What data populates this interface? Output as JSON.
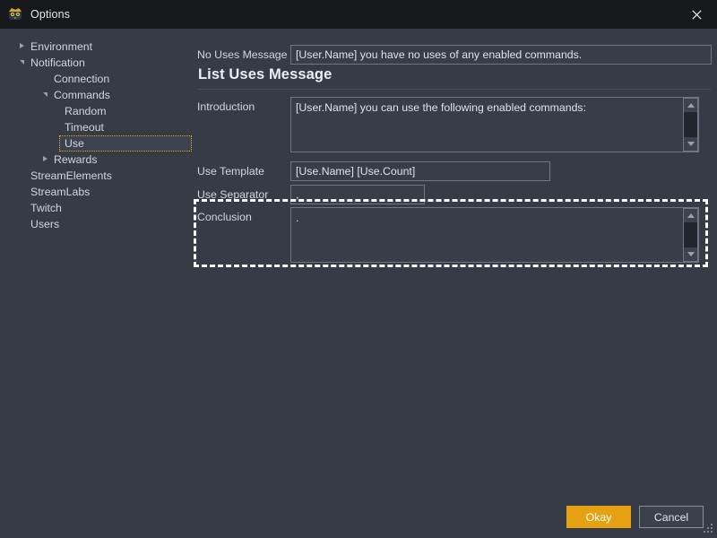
{
  "window": {
    "title": "Options",
    "icon": "app-mascot-icon",
    "close_icon": "close-icon",
    "titlebar_color": "#17181c",
    "background_color": "#363b45",
    "accent_color": "#e5a112",
    "focus_outline_color": "#e2a025"
  },
  "sidebar": {
    "items": [
      {
        "label": "Environment",
        "depth": 0,
        "arrow": "collapsed",
        "selected": false
      },
      {
        "label": "Notification",
        "depth": 0,
        "arrow": "expanded",
        "selected": false
      },
      {
        "label": "Connection",
        "depth": 1,
        "arrow": "none",
        "selected": false
      },
      {
        "label": "Commands",
        "depth": 1,
        "arrow": "expanded",
        "selected": false
      },
      {
        "label": "Random",
        "depth": 2,
        "arrow": "none",
        "selected": false
      },
      {
        "label": "Timeout",
        "depth": 2,
        "arrow": "none",
        "selected": false
      },
      {
        "label": "Use",
        "depth": 2,
        "arrow": "none",
        "selected": true
      },
      {
        "label": "Rewards",
        "depth": 1,
        "arrow": "collapsed",
        "selected": false
      },
      {
        "label": "StreamElements",
        "depth": 0,
        "arrow": "none",
        "selected": false
      },
      {
        "label": "StreamLabs",
        "depth": 0,
        "arrow": "none",
        "selected": false
      },
      {
        "label": "Twitch",
        "depth": 0,
        "arrow": "none",
        "selected": false
      },
      {
        "label": "Users",
        "depth": 0,
        "arrow": "none",
        "selected": false
      }
    ]
  },
  "main": {
    "no_uses_message": {
      "label": "No Uses Message",
      "value": "[User.Name] you have no uses of any enabled commands."
    },
    "section": {
      "title": "List Uses Message"
    },
    "introduction": {
      "label": "Introduction",
      "value": "[User.Name] you can use the following enabled commands:",
      "scrollbar": {
        "up_icon": "scroll-up-arrow-icon",
        "down_icon": "scroll-down-arrow-icon"
      }
    },
    "use_template": {
      "label": "Use Template",
      "value": "[Use.Name] [Use.Count]"
    },
    "use_separator": {
      "label": "Use Separator",
      "value": ","
    },
    "conclusion": {
      "label": "Conclusion",
      "value": ".",
      "scrollbar": {
        "up_icon": "scroll-up-arrow-icon",
        "down_icon": "scroll-down-arrow-icon"
      }
    }
  },
  "footer": {
    "okay_label": "Okay",
    "cancel_label": "Cancel"
  }
}
